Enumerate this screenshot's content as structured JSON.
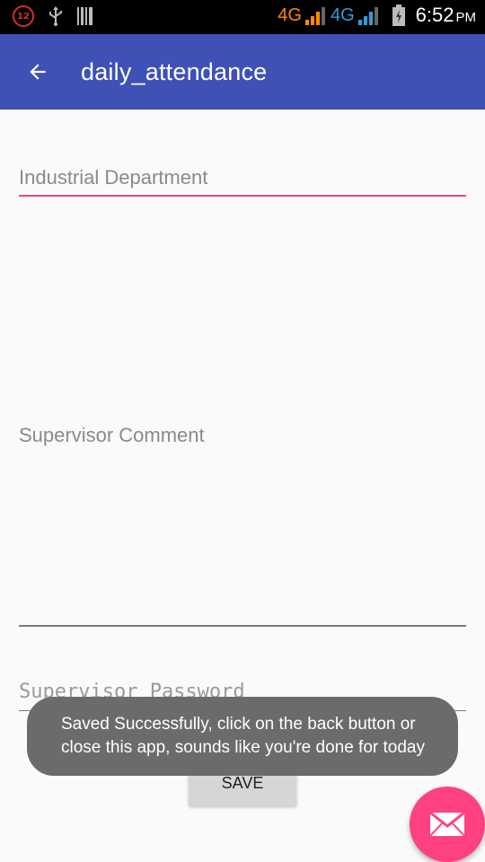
{
  "status_bar": {
    "notification_count": "12",
    "network_1": "4G",
    "network_2": "4G",
    "time": "6:52",
    "ampm": "PM",
    "colors": {
      "network_1": "#ff8a00",
      "network_2": "#2d9cdb",
      "background": "#000000"
    }
  },
  "app_bar": {
    "title": "daily_attendance",
    "back_icon": "arrow-back-icon",
    "color": "#3f51b5"
  },
  "form": {
    "department_value": "Industrial Department",
    "comment_placeholder": "Supervisor Comment",
    "password_placeholder": "Supervisor Password",
    "save_label": "SAVE"
  },
  "toast": {
    "message": "Saved Successfully, click on the back button or\nclose this app, sounds like you're done for today"
  },
  "fab": {
    "icon": "email-icon",
    "color": "#ff4081"
  },
  "accent_color": "#e84a7a"
}
